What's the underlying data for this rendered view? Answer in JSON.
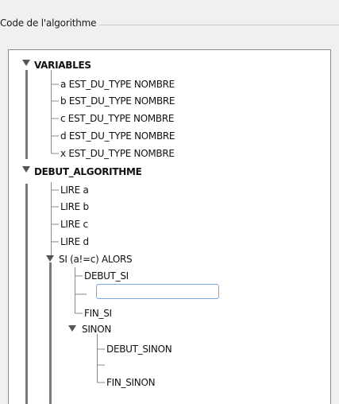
{
  "group": {
    "title": "Code de l'algorithme"
  },
  "tree": {
    "variables": {
      "label": "VARIABLES",
      "items": [
        "a EST_DU_TYPE NOMBRE",
        "b EST_DU_TYPE NOMBRE",
        "c EST_DU_TYPE NOMBRE",
        "d EST_DU_TYPE NOMBRE",
        "x EST_DU_TYPE NOMBRE"
      ]
    },
    "debut": {
      "label": "DEBUT_ALGORITHME",
      "items": [
        "LIRE a",
        "LIRE b",
        "LIRE c",
        "LIRE d"
      ],
      "si": {
        "label": "SI (a!=c) ALORS",
        "debut_si": "DEBUT_SI",
        "edit_value": "",
        "fin_si": "FIN_SI",
        "sinon": {
          "label": "SINON",
          "debut_sinon": "DEBUT_SINON",
          "fin_sinon": "FIN_SINON"
        }
      }
    }
  }
}
